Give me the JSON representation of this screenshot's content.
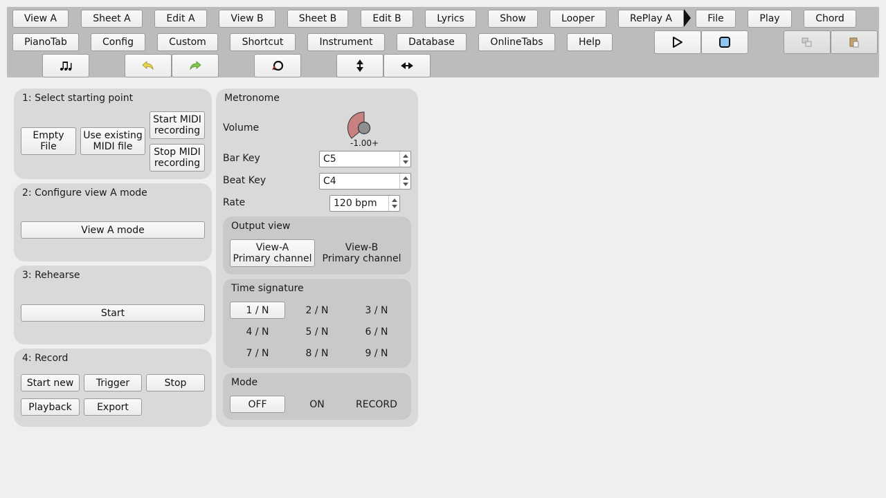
{
  "toolbar": {
    "row1": [
      "View A",
      "Sheet A",
      "Edit A",
      "View B",
      "Sheet B",
      "Edit B",
      "Lyrics",
      "Show",
      "Looper",
      "RePlay A",
      "File",
      "Play",
      "Chord"
    ],
    "row2": [
      "PianoTab",
      "Config",
      "Custom",
      "Shortcut",
      "Instrument",
      "Database",
      "OnlineTabs",
      "Help"
    ],
    "icons": {
      "play": "play-icon",
      "stop": "stop-icon",
      "copy": "copy-icon",
      "paste": "paste-icon",
      "notes": "music-notes-icon",
      "undo": "undo-icon",
      "redo": "redo-icon",
      "loop": "loop-icon",
      "vertical": "vertical-resize-icon",
      "horizontal": "horizontal-resize-icon"
    }
  },
  "step1": {
    "title": "1: Select starting point",
    "empty_file": "Empty\nFile",
    "use_existing": "Use existing\nMIDI file",
    "start_midi": "Start MIDI\nrecording",
    "stop_midi": "Stop MIDI\nrecording"
  },
  "step2": {
    "title": "2: Configure view A mode",
    "button": "View A mode"
  },
  "step3": {
    "title": "3: Rehearse",
    "button": "Start"
  },
  "step4": {
    "title": "4: Record",
    "start_new": "Start new",
    "trigger": "Trigger",
    "stop": "Stop",
    "playback": "Playback",
    "export": "Export"
  },
  "metronome": {
    "title": "Metronome",
    "volume_label": "Volume",
    "volume_value": "-1.00+",
    "volume_level": -1.0,
    "bar_key_label": "Bar Key",
    "bar_key": "C5",
    "beat_key_label": "Beat Key",
    "beat_key": "C4",
    "rate_label": "Rate",
    "rate": "120 bpm",
    "output_view": {
      "title": "Output view",
      "options": [
        "View-A\nPrimary channel",
        "View-B\nPrimary channel"
      ],
      "selected": 0
    },
    "time_signature": {
      "title": "Time signature",
      "options": [
        "1 / N",
        "2 / N",
        "3 / N",
        "4 / N",
        "5 / N",
        "6 / N",
        "7 / N",
        "8 / N",
        "9 / N"
      ],
      "selected": 0
    },
    "mode": {
      "title": "Mode",
      "options": [
        "OFF",
        "ON",
        "RECORD"
      ],
      "selected": 0
    }
  },
  "colors": {
    "toolbar_bg": "#bcbcbc",
    "panel_bg": "#d9d9d9",
    "subpanel_bg": "#c9c9c9",
    "knob_fill": "#c98080",
    "stop_fill": "#8fc6f0",
    "undo_redo": "#e8d84a",
    "redo": "#7fc84a"
  }
}
